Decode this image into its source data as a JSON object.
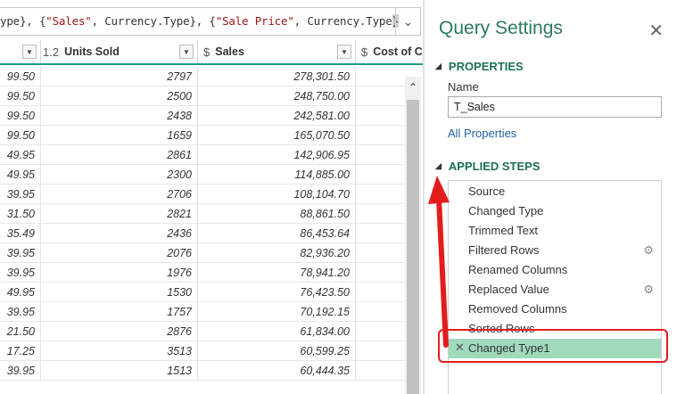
{
  "formula": {
    "pre": "ype}, {",
    "s1": "\"Sales\"",
    "mid": ", Currency.Type}, {",
    "s2": "\"Sale Price\"",
    "post": ", Currency.Type",
    "end": "}"
  },
  "grid": {
    "headers": [
      {
        "type": "1.2",
        "label": "Units Sold"
      },
      {
        "type": "$",
        "label": "Sales"
      },
      {
        "type": "$",
        "label": "Cost of C"
      }
    ],
    "rows": [
      [
        "99.50",
        "2797",
        "278,301.50"
      ],
      [
        "99.50",
        "2500",
        "248,750.00"
      ],
      [
        "99.50",
        "2438",
        "242,581.00"
      ],
      [
        "99.50",
        "1659",
        "165,070.50"
      ],
      [
        "49.95",
        "2861",
        "142,906.95"
      ],
      [
        "49.95",
        "2300",
        "114,885.00"
      ],
      [
        "39.95",
        "2706",
        "108,104.70"
      ],
      [
        "31.50",
        "2821",
        "88,861.50"
      ],
      [
        "35.49",
        "2436",
        "86,453.64"
      ],
      [
        "39.95",
        "2076",
        "82,936.20"
      ],
      [
        "39.95",
        "1976",
        "78,941.20"
      ],
      [
        "49.95",
        "1530",
        "76,423.50"
      ],
      [
        "39.95",
        "1757",
        "70,192.15"
      ],
      [
        "21.50",
        "2876",
        "61,834.00"
      ],
      [
        "17.25",
        "3513",
        "60,599.25"
      ],
      [
        "39.95",
        "1513",
        "60,444.35"
      ]
    ]
  },
  "settings": {
    "title": "Query Settings",
    "properties_heading": "PROPERTIES",
    "name_label": "Name",
    "name_value": "T_Sales",
    "all_properties": "All Properties",
    "applied_steps_heading": "APPLIED STEPS",
    "steps": [
      {
        "label": "Source",
        "gear": false
      },
      {
        "label": "Changed Type",
        "gear": false
      },
      {
        "label": "Trimmed Text",
        "gear": false
      },
      {
        "label": "Filtered Rows",
        "gear": true
      },
      {
        "label": "Renamed Columns",
        "gear": false
      },
      {
        "label": "Replaced Value",
        "gear": true
      },
      {
        "label": "Removed Columns",
        "gear": false
      },
      {
        "label": "Sorted Rows",
        "gear": false
      },
      {
        "label": "Changed Type1",
        "gear": false,
        "selected": true
      }
    ]
  },
  "colors": {
    "accent_green": "#2c7a5f",
    "selected_step": "#a1d9bc",
    "header_underline": "#1e9a8a",
    "callout_red": "#e41c1c"
  }
}
